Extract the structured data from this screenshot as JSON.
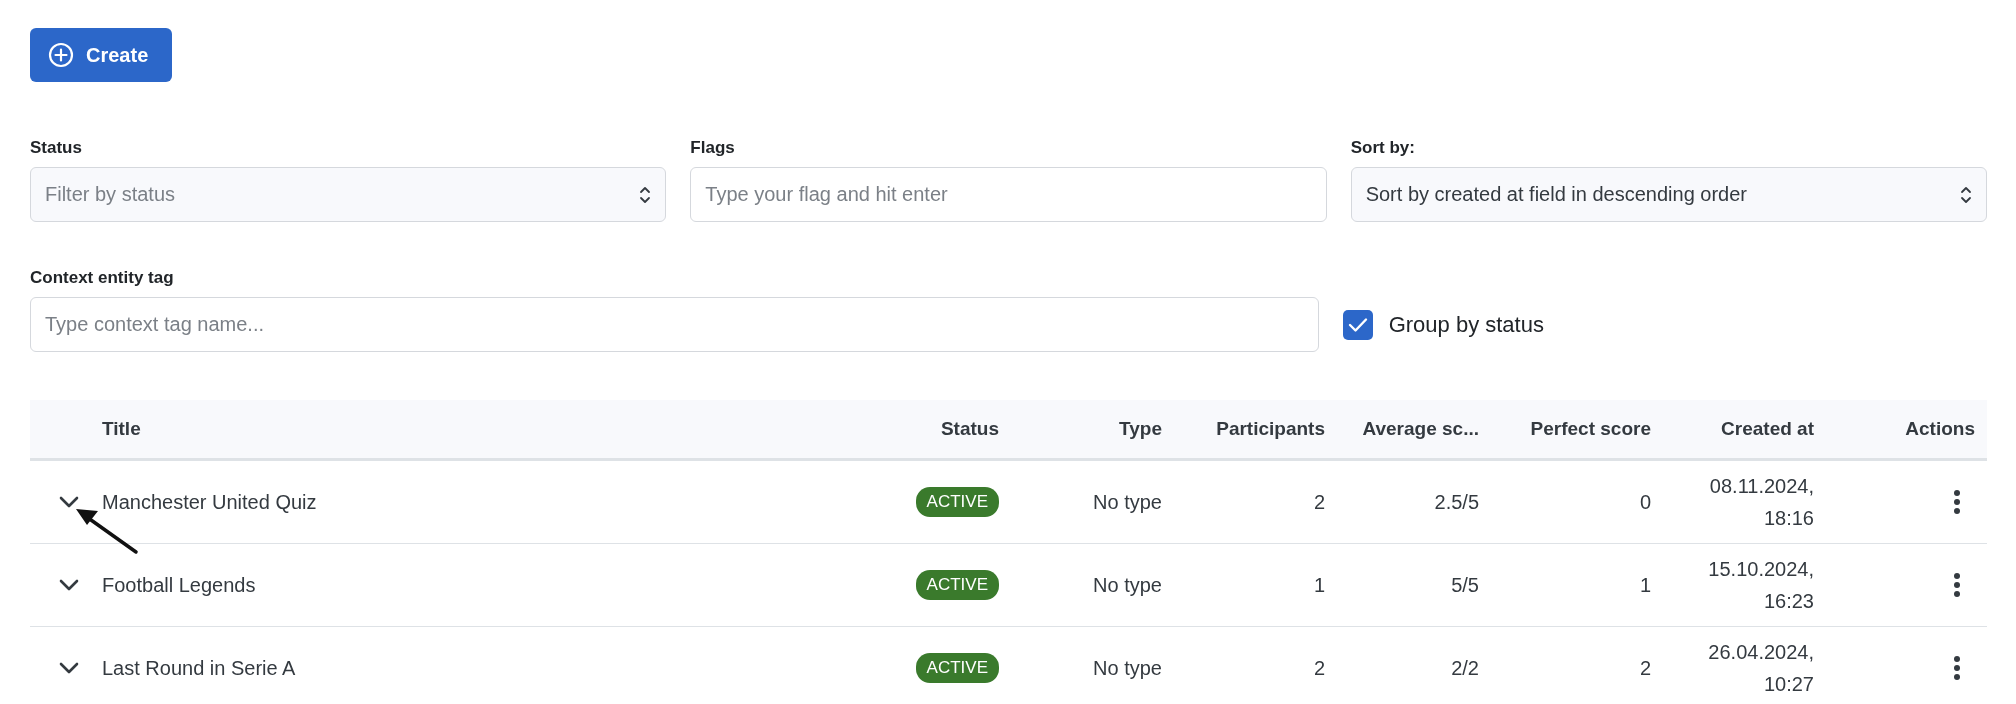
{
  "create_button": {
    "label": "Create"
  },
  "filters": [
    {
      "kind": "select",
      "label": "Status",
      "placeholder": "Filter by status"
    },
    {
      "kind": "text",
      "label": "Flags",
      "placeholder": "Type your flag and hit enter"
    },
    {
      "kind": "select",
      "label": "Sort by:",
      "value": "Sort by created at field in descending order"
    }
  ],
  "context_filter": {
    "label": "Context entity tag",
    "placeholder": "Type context tag name..."
  },
  "group_by_status": {
    "label": "Group by status",
    "checked": true
  },
  "table": {
    "columns": [
      {
        "label": "Title"
      },
      {
        "label": "Status"
      },
      {
        "label": "Type"
      },
      {
        "label": "Participants"
      },
      {
        "label": "Average sc..."
      },
      {
        "label": "Perfect score"
      },
      {
        "label": "Created at"
      },
      {
        "label": "Actions"
      }
    ],
    "rows": [
      {
        "expanded": false,
        "title": "Manchester United Quiz",
        "status": "ACTIVE",
        "type": "No type",
        "participants": "2",
        "average_score": "2.5/5",
        "perfect_score": "0",
        "created_date": "08.11.2024,",
        "created_time": "18:16"
      },
      {
        "expanded": false,
        "title": "Football Legends",
        "status": "ACTIVE",
        "type": "No type",
        "participants": "1",
        "average_score": "5/5",
        "perfect_score": "1",
        "created_date": "15.10.2024,",
        "created_time": "16:23"
      },
      {
        "expanded": false,
        "title": "Last Round in Serie A",
        "status": "ACTIVE",
        "type": "No type",
        "participants": "2",
        "average_score": "2/2",
        "perfect_score": "2",
        "created_date": "26.04.2024,",
        "created_time": "10:27"
      }
    ]
  }
}
